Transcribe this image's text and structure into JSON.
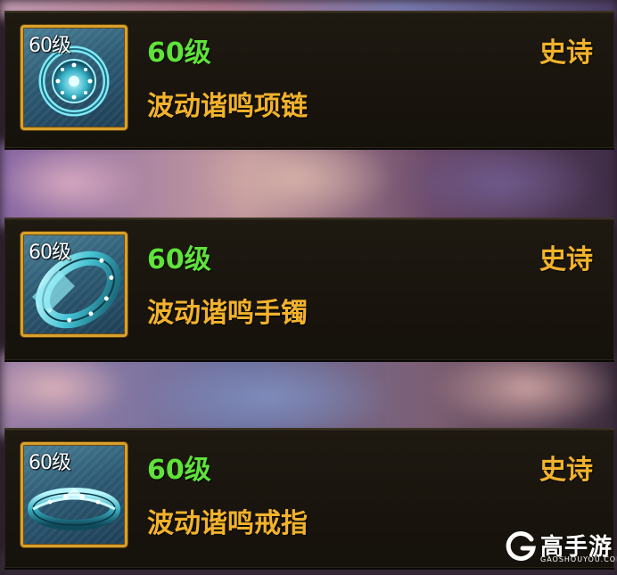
{
  "colors": {
    "level": "#5fe23a",
    "name": "#f2b22c",
    "rarity": "#f2b22c",
    "frame": "#d9a12b",
    "card_bg": "#1a150e"
  },
  "items": [
    {
      "level_tag": "60级",
      "level": "60级",
      "name": "波动谐鸣项链",
      "rarity": "史诗",
      "icon": "necklace-icon"
    },
    {
      "level_tag": "60级",
      "level": "60级",
      "name": "波动谐鸣手镯",
      "rarity": "史诗",
      "icon": "bracelet-icon"
    },
    {
      "level_tag": "60级",
      "level": "60级",
      "name": "波动谐鸣戒指",
      "rarity": "史诗",
      "icon": "ring-icon"
    }
  ],
  "watermark": {
    "brand": "高手游",
    "domain": "GAOSHOUYOU.COM"
  }
}
